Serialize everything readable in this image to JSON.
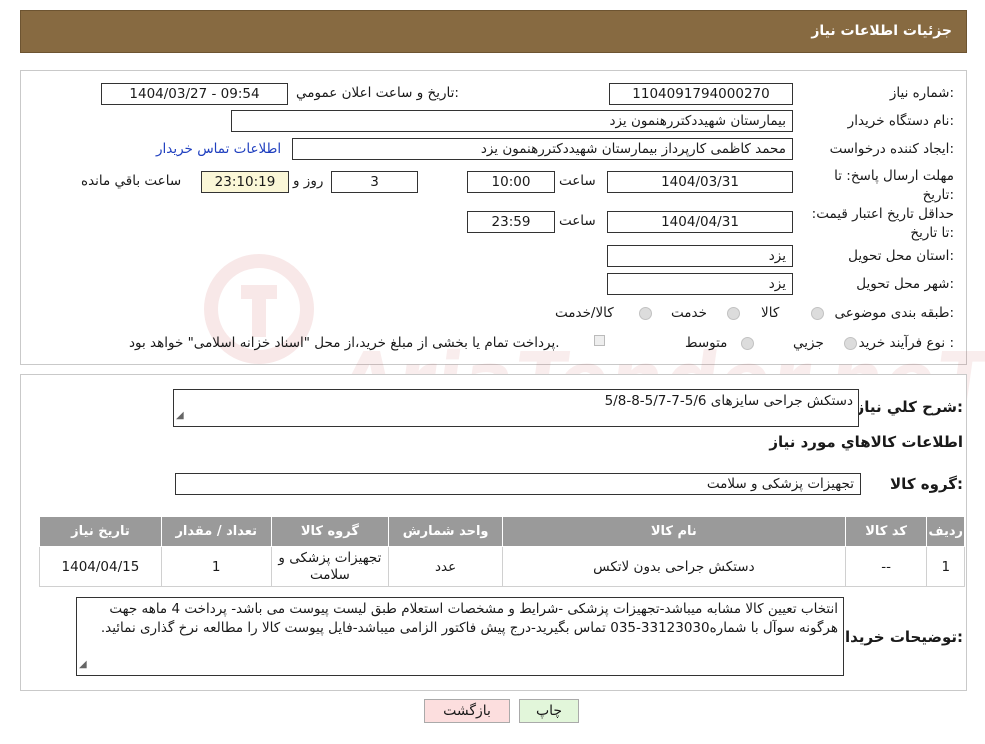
{
  "header": {
    "title": "جزئیات اطلاعات نیاز"
  },
  "watermark": {
    "text": "AriaTender.neT"
  },
  "form": {
    "need_number": {
      "label": "شماره نیاز:",
      "value": "1104091794000270"
    },
    "announce_datetime": {
      "label": "تاریخ و ساعت اعلان عمومي:",
      "value": "1404/03/27 - 09:54"
    },
    "buyer_org": {
      "label": "نام دستگاه خريدار:",
      "value": "بیمارستان شهیددکتررهنمون یزد"
    },
    "creator": {
      "label": "ايجاد کننده درخواست:",
      "value": "محمد کاظمی کارپرداز بیمارستان شهیددکتررهنمون یزد",
      "contact_link": "اطلاعات تماس خريدار"
    },
    "reply_deadline": {
      "label": "مهلت ارسال پاسخ: تا تاریخ:",
      "date": "1404/03/31",
      "time_label": "ساعت",
      "time": "10:00",
      "days": "3",
      "days_label": "روز و",
      "remaining": "23:10:19",
      "remaining_label": "ساعت باقي مانده"
    },
    "price_validity": {
      "label": "حداقل تاريخ اعتبار قيمت: تا تاریخ:",
      "date": "1404/04/31",
      "time_label": "ساعت",
      "time": "23:59"
    },
    "province": {
      "label": "استان محل تحويل:",
      "value": "یزد"
    },
    "city": {
      "label": "شهر محل تحويل:",
      "value": "یزد"
    },
    "category": {
      "label": "طبقه بندی موضوعی:",
      "options": [
        "کالا",
        "خدمت",
        "کالا/خدمت"
      ]
    },
    "purchase_type": {
      "label": "نوع فرآيند خريد :",
      "options": [
        "جزيي",
        "متوسط"
      ],
      "note": "پرداخت تمام يا بخشی از مبلغ خريد،از محل \"اسناد خزانه اسلامی\" خواهد بود."
    }
  },
  "details": {
    "general_desc": {
      "label": "شرح کلي نياز:",
      "value": "دستکش جراحی سایزهای 5/6-7-5/7-8-5/8"
    },
    "section_title": "اطلاعات کالاهاي مورد نياز",
    "group": {
      "label": "گروه کالا:",
      "value": "تجهیزات پزشکی و سلامت"
    },
    "table": {
      "headers": [
        "رديف",
        "کد کالا",
        "نام کالا",
        "واحد شمارش",
        "گروه کالا",
        "تعداد / مقدار",
        "تاريخ نياز"
      ],
      "rows": [
        {
          "row": "1",
          "code": "--",
          "name": "دستکش جراحی بدون لاتکس",
          "unit": "عدد",
          "group": "تجهیزات پزشکی و سلامت",
          "qty": "1",
          "date": "1404/04/15"
        }
      ]
    },
    "buyer_notes": {
      "label": "توضيحات خريدار:",
      "value": "انتخاب تعیین کالا مشابه میباشد-تجهیزات پزشکی -شرایط و مشخصات استعلام طبق لیست پیوست می باشد- پرداخت 4 ماهه جهت هرگونه سوآل با شماره33123030-035 تماس بگیرید-درج پیش فاکتور الزامی میباشد-فایل پیوست کالا را مطالعه نرخ گذاری نمائید."
    }
  },
  "buttons": {
    "print": "چاپ",
    "back": "بازگشت"
  }
}
